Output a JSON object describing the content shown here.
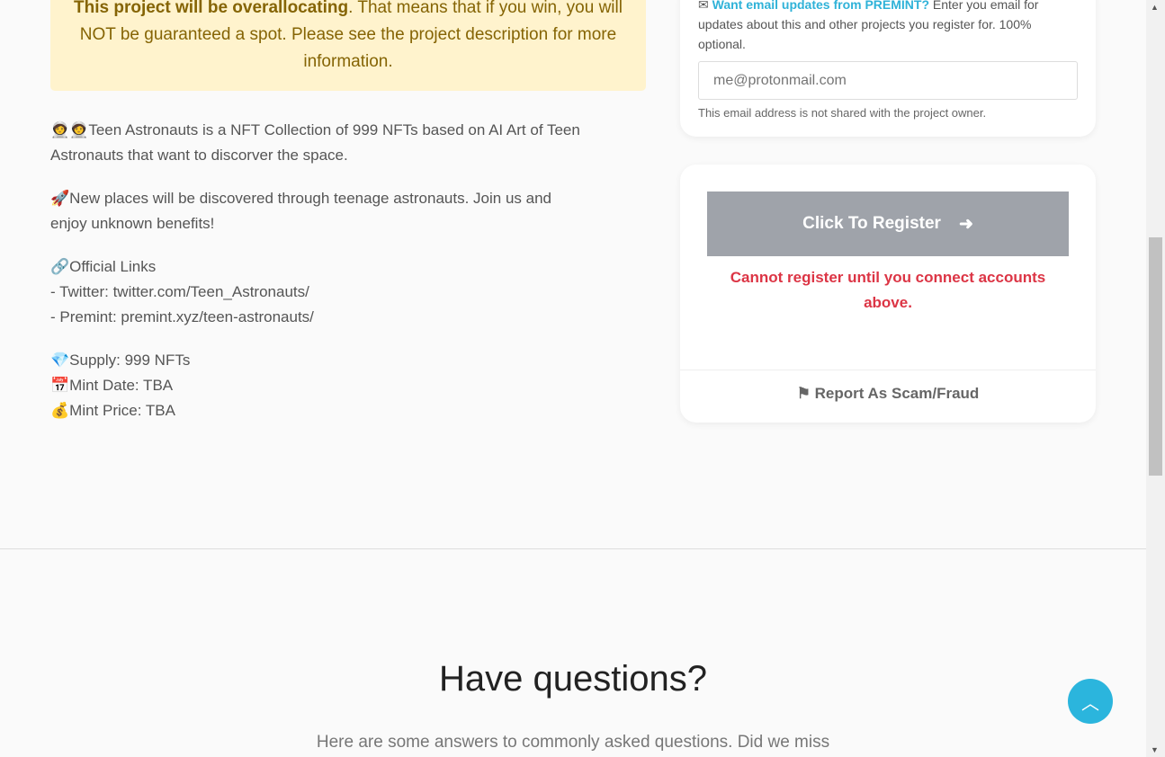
{
  "alert": {
    "bold": "This project will be overallocating",
    "rest": ". That means that if you win, you will NOT be guaranteed a spot. Please see the project description for more information."
  },
  "description": {
    "p1": "🧑‍🚀🧑‍🚀Teen Astronauts is a NFT Collection of 999 NFTs based on AI Art of Teen Astronauts that want to discorver the space.",
    "p2": "🚀New places will be discovered through teenage astronauts. Join us and enjoy unknown benefits!",
    "links_title": "🔗Official Links",
    "twitter": "- Twitter: twitter.com/Teen_Astronauts/",
    "premint": "- Premint: premint.xyz/teen-astronauts/",
    "supply": "💎Supply: 999 NFTs",
    "mint_date": "📅Mint Date: TBA",
    "mint_price": "💰Mint Price: TBA"
  },
  "email": {
    "link": "Want email updates from PREMINT?",
    "text": " Enter you email for updates about this and other projects you register for. 100% optional.",
    "placeholder": "me@protonmail.com",
    "note": "This email address is not shared with the project owner."
  },
  "register": {
    "button": "Click To Register",
    "error": "Cannot register until you connect accounts above.",
    "report": "Report As Scam/Fraud"
  },
  "faq": {
    "title": "Have questions?",
    "subtitle": "Here are some answers to commonly asked questions. Did we miss"
  }
}
